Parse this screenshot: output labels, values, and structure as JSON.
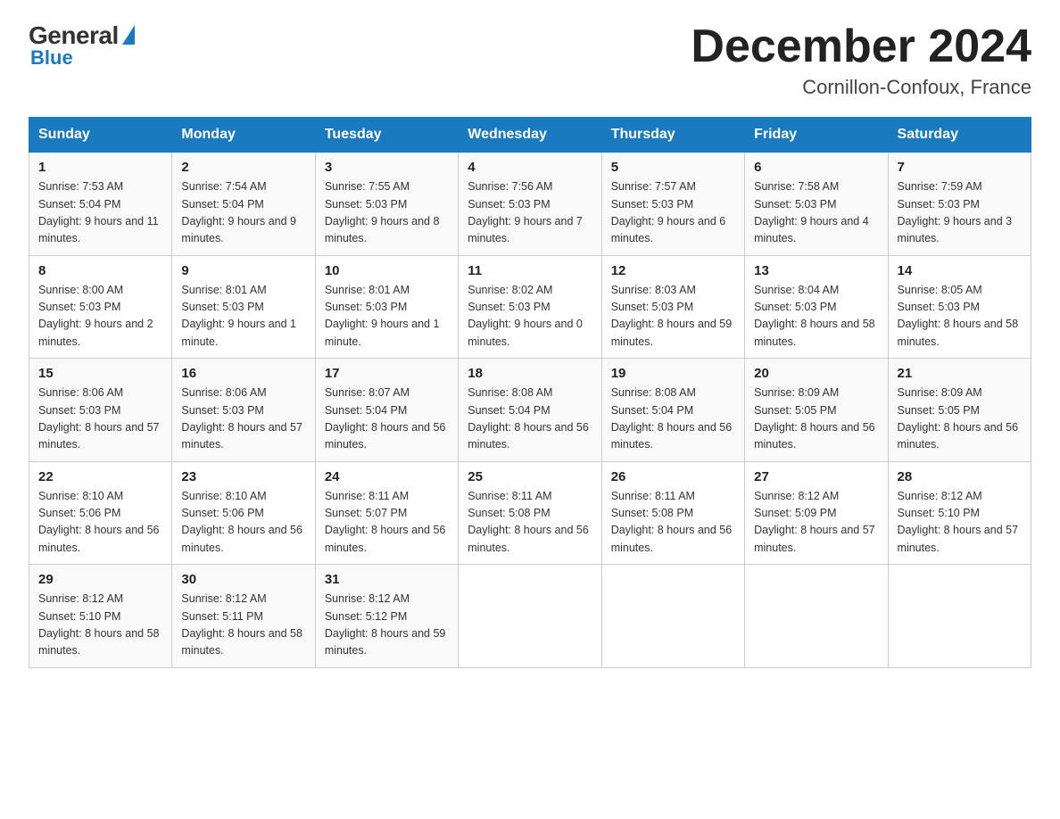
{
  "header": {
    "logo_general": "General",
    "logo_blue": "Blue",
    "month_year": "December 2024",
    "location": "Cornillon-Confoux, France"
  },
  "days_of_week": [
    "Sunday",
    "Monday",
    "Tuesday",
    "Wednesday",
    "Thursday",
    "Friday",
    "Saturday"
  ],
  "weeks": [
    [
      {
        "day": "1",
        "sunrise": "7:53 AM",
        "sunset": "5:04 PM",
        "daylight": "9 hours and 11 minutes."
      },
      {
        "day": "2",
        "sunrise": "7:54 AM",
        "sunset": "5:04 PM",
        "daylight": "9 hours and 9 minutes."
      },
      {
        "day": "3",
        "sunrise": "7:55 AM",
        "sunset": "5:03 PM",
        "daylight": "9 hours and 8 minutes."
      },
      {
        "day": "4",
        "sunrise": "7:56 AM",
        "sunset": "5:03 PM",
        "daylight": "9 hours and 7 minutes."
      },
      {
        "day": "5",
        "sunrise": "7:57 AM",
        "sunset": "5:03 PM",
        "daylight": "9 hours and 6 minutes."
      },
      {
        "day": "6",
        "sunrise": "7:58 AM",
        "sunset": "5:03 PM",
        "daylight": "9 hours and 4 minutes."
      },
      {
        "day": "7",
        "sunrise": "7:59 AM",
        "sunset": "5:03 PM",
        "daylight": "9 hours and 3 minutes."
      }
    ],
    [
      {
        "day": "8",
        "sunrise": "8:00 AM",
        "sunset": "5:03 PM",
        "daylight": "9 hours and 2 minutes."
      },
      {
        "day": "9",
        "sunrise": "8:01 AM",
        "sunset": "5:03 PM",
        "daylight": "9 hours and 1 minute."
      },
      {
        "day": "10",
        "sunrise": "8:01 AM",
        "sunset": "5:03 PM",
        "daylight": "9 hours and 1 minute."
      },
      {
        "day": "11",
        "sunrise": "8:02 AM",
        "sunset": "5:03 PM",
        "daylight": "9 hours and 0 minutes."
      },
      {
        "day": "12",
        "sunrise": "8:03 AM",
        "sunset": "5:03 PM",
        "daylight": "8 hours and 59 minutes."
      },
      {
        "day": "13",
        "sunrise": "8:04 AM",
        "sunset": "5:03 PM",
        "daylight": "8 hours and 58 minutes."
      },
      {
        "day": "14",
        "sunrise": "8:05 AM",
        "sunset": "5:03 PM",
        "daylight": "8 hours and 58 minutes."
      }
    ],
    [
      {
        "day": "15",
        "sunrise": "8:06 AM",
        "sunset": "5:03 PM",
        "daylight": "8 hours and 57 minutes."
      },
      {
        "day": "16",
        "sunrise": "8:06 AM",
        "sunset": "5:03 PM",
        "daylight": "8 hours and 57 minutes."
      },
      {
        "day": "17",
        "sunrise": "8:07 AM",
        "sunset": "5:04 PM",
        "daylight": "8 hours and 56 minutes."
      },
      {
        "day": "18",
        "sunrise": "8:08 AM",
        "sunset": "5:04 PM",
        "daylight": "8 hours and 56 minutes."
      },
      {
        "day": "19",
        "sunrise": "8:08 AM",
        "sunset": "5:04 PM",
        "daylight": "8 hours and 56 minutes."
      },
      {
        "day": "20",
        "sunrise": "8:09 AM",
        "sunset": "5:05 PM",
        "daylight": "8 hours and 56 minutes."
      },
      {
        "day": "21",
        "sunrise": "8:09 AM",
        "sunset": "5:05 PM",
        "daylight": "8 hours and 56 minutes."
      }
    ],
    [
      {
        "day": "22",
        "sunrise": "8:10 AM",
        "sunset": "5:06 PM",
        "daylight": "8 hours and 56 minutes."
      },
      {
        "day": "23",
        "sunrise": "8:10 AM",
        "sunset": "5:06 PM",
        "daylight": "8 hours and 56 minutes."
      },
      {
        "day": "24",
        "sunrise": "8:11 AM",
        "sunset": "5:07 PM",
        "daylight": "8 hours and 56 minutes."
      },
      {
        "day": "25",
        "sunrise": "8:11 AM",
        "sunset": "5:08 PM",
        "daylight": "8 hours and 56 minutes."
      },
      {
        "day": "26",
        "sunrise": "8:11 AM",
        "sunset": "5:08 PM",
        "daylight": "8 hours and 56 minutes."
      },
      {
        "day": "27",
        "sunrise": "8:12 AM",
        "sunset": "5:09 PM",
        "daylight": "8 hours and 57 minutes."
      },
      {
        "day": "28",
        "sunrise": "8:12 AM",
        "sunset": "5:10 PM",
        "daylight": "8 hours and 57 minutes."
      }
    ],
    [
      {
        "day": "29",
        "sunrise": "8:12 AM",
        "sunset": "5:10 PM",
        "daylight": "8 hours and 58 minutes."
      },
      {
        "day": "30",
        "sunrise": "8:12 AM",
        "sunset": "5:11 PM",
        "daylight": "8 hours and 58 minutes."
      },
      {
        "day": "31",
        "sunrise": "8:12 AM",
        "sunset": "5:12 PM",
        "daylight": "8 hours and 59 minutes."
      },
      null,
      null,
      null,
      null
    ]
  ]
}
